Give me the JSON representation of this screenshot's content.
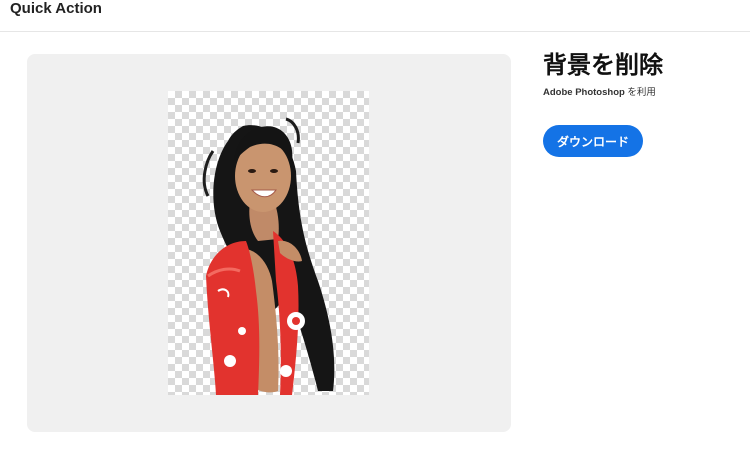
{
  "header": {
    "title": "Quick Action"
  },
  "action": {
    "title": "背景を削除",
    "powered_app": "Adobe Photoshop",
    "powered_suffix": " を利用",
    "download_label": "ダウンロード"
  },
  "colors": {
    "accent": "#1473e6",
    "panel_bg": "#f0f0f0",
    "checker": "#d9d9d9"
  },
  "preview": {
    "image_description_icon": "person-photo-transparent-bg"
  }
}
